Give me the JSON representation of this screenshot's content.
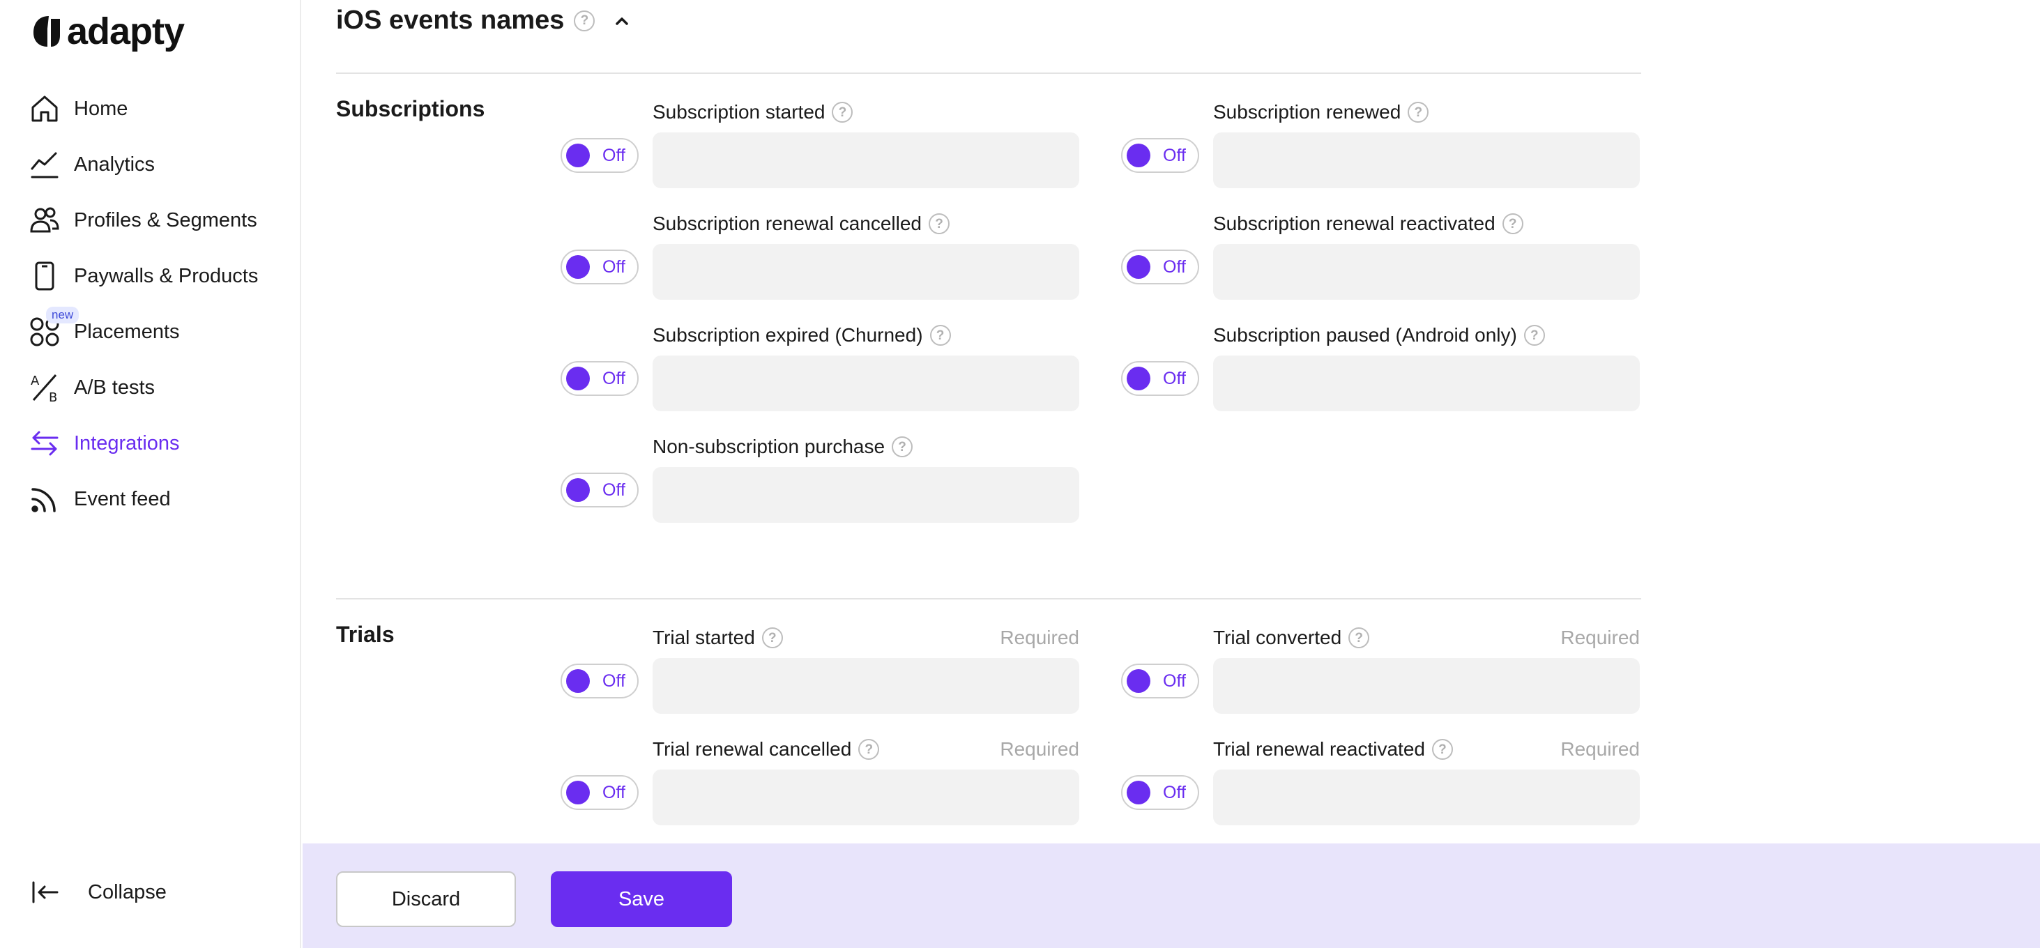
{
  "brand": {
    "name": "adapty",
    "accent": "#6a2df0"
  },
  "sidebar": {
    "items": [
      {
        "label": "Home",
        "icon": "home-icon",
        "active": false
      },
      {
        "label": "Analytics",
        "icon": "analytics-icon",
        "active": false
      },
      {
        "label": "Profiles & Segments",
        "icon": "profiles-icon",
        "active": false
      },
      {
        "label": "Paywalls & Products",
        "icon": "phone-icon",
        "active": false
      },
      {
        "label": "Placements",
        "icon": "placements-icon",
        "active": false,
        "badge": "new"
      },
      {
        "label": "A/B tests",
        "icon": "ab-tests-icon",
        "active": false
      },
      {
        "label": "Integrations",
        "icon": "integrations-icon",
        "active": true
      },
      {
        "label": "Event feed",
        "icon": "event-feed-icon",
        "active": false
      }
    ],
    "collapse_label": "Collapse"
  },
  "section": {
    "title": "iOS events names"
  },
  "groups": {
    "subscriptions": {
      "title": "Subscriptions",
      "fields": [
        {
          "label": "Subscription started",
          "toggle": "Off",
          "required": ""
        },
        {
          "label": "Subscription renewed",
          "toggle": "Off",
          "required": ""
        },
        {
          "label": "Subscription renewal cancelled",
          "toggle": "Off",
          "required": ""
        },
        {
          "label": "Subscription renewal reactivated",
          "toggle": "Off",
          "required": ""
        },
        {
          "label": "Subscription expired (Churned)",
          "toggle": "Off",
          "required": ""
        },
        {
          "label": "Subscription paused (Android only)",
          "toggle": "Off",
          "required": ""
        },
        {
          "label": "Non-subscription purchase",
          "toggle": "Off",
          "required": ""
        }
      ]
    },
    "trials": {
      "title": "Trials",
      "fields": [
        {
          "label": "Trial started",
          "toggle": "Off",
          "required": "Required"
        },
        {
          "label": "Trial converted",
          "toggle": "Off",
          "required": "Required"
        },
        {
          "label": "Trial renewal cancelled",
          "toggle": "Off",
          "required": "Required"
        },
        {
          "label": "Trial renewal reactivated",
          "toggle": "Off",
          "required": "Required"
        }
      ]
    }
  },
  "footer": {
    "discard_label": "Discard",
    "save_label": "Save"
  }
}
